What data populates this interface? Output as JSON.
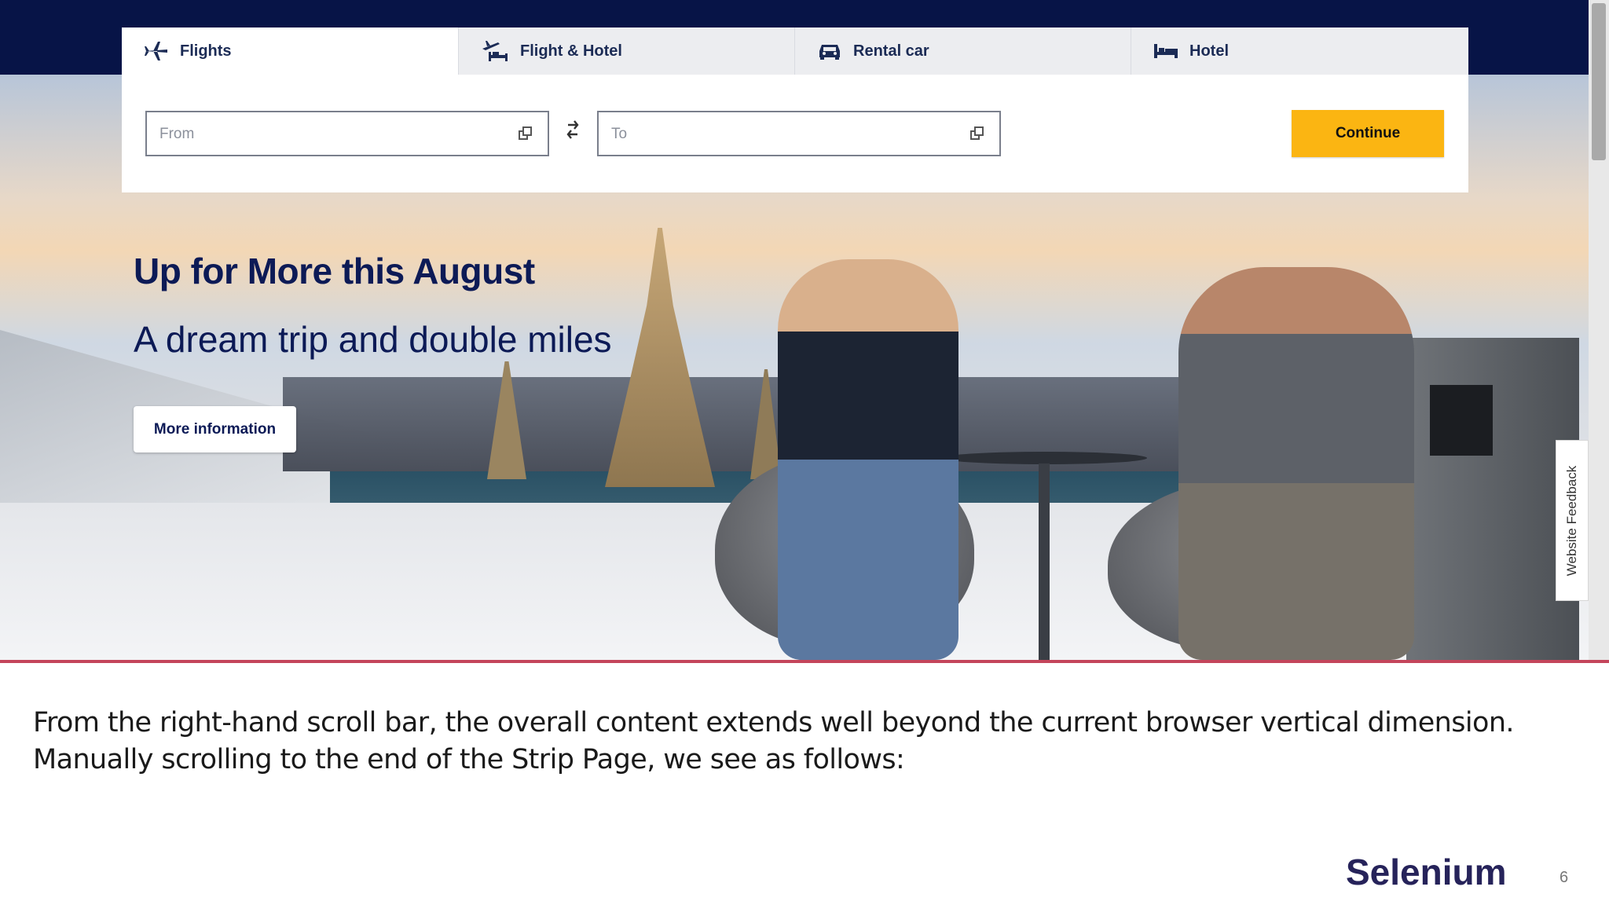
{
  "booking": {
    "tabs": [
      {
        "label": "Flights",
        "icon": "plane-icon",
        "active": true
      },
      {
        "label": "Flight & Hotel",
        "icon": "plane-bed-icon",
        "active": false
      },
      {
        "label": "Rental car",
        "icon": "car-icon",
        "active": false
      },
      {
        "label": "Hotel",
        "icon": "bed-icon",
        "active": false
      }
    ],
    "from_placeholder": "From",
    "to_placeholder": "To",
    "continue_label": "Continue",
    "accent_color": "#fbb512",
    "nav_color": "#071447"
  },
  "hero": {
    "headline": "Up for More this August",
    "subline": "A dream trip and double miles",
    "more_info_label": "More information"
  },
  "feedback_label": "Website Feedback",
  "slide": {
    "caption": "From the right-hand scroll bar, the overall content extends well beyond the current browser vertical dimension. Manually scrolling to the end of the Strip Page, we see as follows:",
    "brand": "Selenium",
    "page_number": "6",
    "divider_color": "#c4455b"
  }
}
